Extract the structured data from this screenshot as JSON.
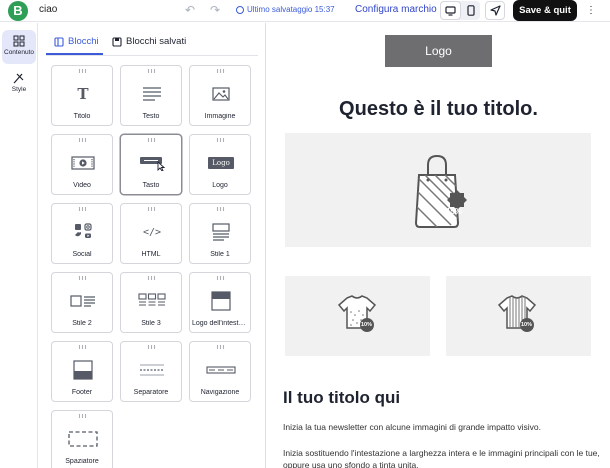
{
  "topbar": {
    "doc_name": "ciao",
    "save_status": "Ultimo salvataggio 15:37",
    "brand_link": "Configura marchio",
    "save_quit": "Save & quit",
    "brand_initial": "B",
    "accent": "#3b5bdb"
  },
  "rail": {
    "items": [
      {
        "label": "Contenuto",
        "icon": "grid-icon"
      },
      {
        "label": "Style",
        "icon": "brush-icon"
      }
    ]
  },
  "panel": {
    "tabs": [
      {
        "label": "Blocchi",
        "icon": "blocks-icon"
      },
      {
        "label": "Blocchi salvati",
        "icon": "save-icon"
      }
    ],
    "blocks": [
      {
        "label": "Titolo",
        "icon": "title-icon"
      },
      {
        "label": "Testo",
        "icon": "text-icon"
      },
      {
        "label": "Immagine",
        "icon": "image-icon"
      },
      {
        "label": "Video",
        "icon": "video-icon"
      },
      {
        "label": "Tasto",
        "icon": "button-icon"
      },
      {
        "label": "Logo",
        "icon": "logo-icon",
        "badge": "Logo"
      },
      {
        "label": "Social",
        "icon": "social-icon"
      },
      {
        "label": "HTML",
        "icon": "code-icon",
        "badge": "</>"
      },
      {
        "label": "Stile 1",
        "icon": "style1-icon"
      },
      {
        "label": "Stile 2",
        "icon": "style2-icon"
      },
      {
        "label": "Stile 3",
        "icon": "style3-icon"
      },
      {
        "label": "Logo dell'intesta...",
        "icon": "header-logo-icon"
      },
      {
        "label": "Footer",
        "icon": "footer-icon"
      },
      {
        "label": "Separatore",
        "icon": "separator-icon"
      },
      {
        "label": "Navigazione",
        "icon": "navigation-icon"
      },
      {
        "label": "Spaziatore",
        "icon": "spacer-icon"
      }
    ]
  },
  "canvas": {
    "logo": "Logo",
    "title": "Questo è il tuo titolo.",
    "hero_badge": "15%",
    "shirt_badge_a": "10%",
    "shirt_badge_b": "10%",
    "heading": "Il tuo titolo qui",
    "paragraph1": "Inizia la tua newsletter con alcune immagini di grande impatto visivo.",
    "paragraph2": "Inizia sostituendo l'intestazione a larghezza intera e le immagini principali con le tue, oppure usa uno sfondo a tinta unita."
  }
}
